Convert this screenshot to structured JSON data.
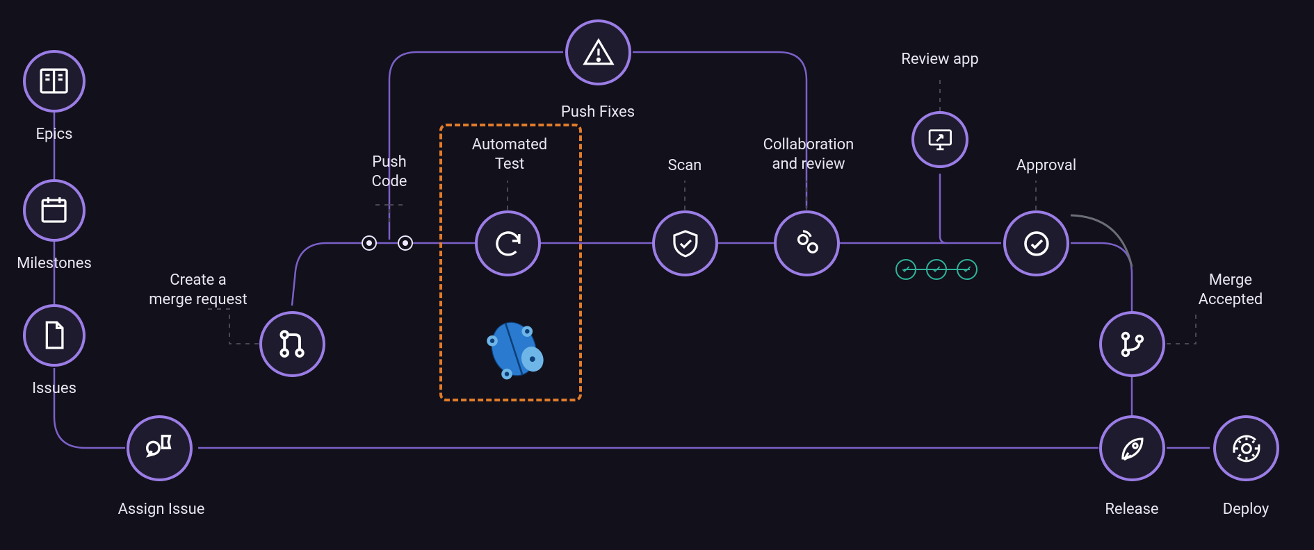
{
  "nodes": {
    "epics": {
      "label": "Epics"
    },
    "milestones": {
      "label": "Milestones"
    },
    "issues": {
      "label": "Issues"
    },
    "assign": {
      "label": "Assign Issue"
    },
    "create_mr": {
      "label": "Create a\nmerge request"
    },
    "push_code": {
      "label": "Push\nCode"
    },
    "auto_test": {
      "label": "Automated\nTest"
    },
    "push_fixes": {
      "label": "Push Fixes"
    },
    "scan": {
      "label": "Scan"
    },
    "collab": {
      "label": "Collaboration\nand review"
    },
    "review_app": {
      "label": "Review app"
    },
    "approval": {
      "label": "Approval"
    },
    "merge_acc": {
      "label": "Merge\nAccepted"
    },
    "release": {
      "label": "Release"
    },
    "deploy": {
      "label": "Deploy"
    }
  },
  "colors": {
    "bg": "#12101a",
    "node_fill": "#1f1b2e",
    "accent": "#9b7de6",
    "accent_light": "#b9a2f0",
    "line": "#7b60c8",
    "line_faded": "#5a4a8a",
    "highlight": "#e07c2b",
    "teal": "#2fb39a",
    "grey_arc": "#6b6d78",
    "text": "#e9e6f2",
    "leader_dash": "#4a4756"
  }
}
